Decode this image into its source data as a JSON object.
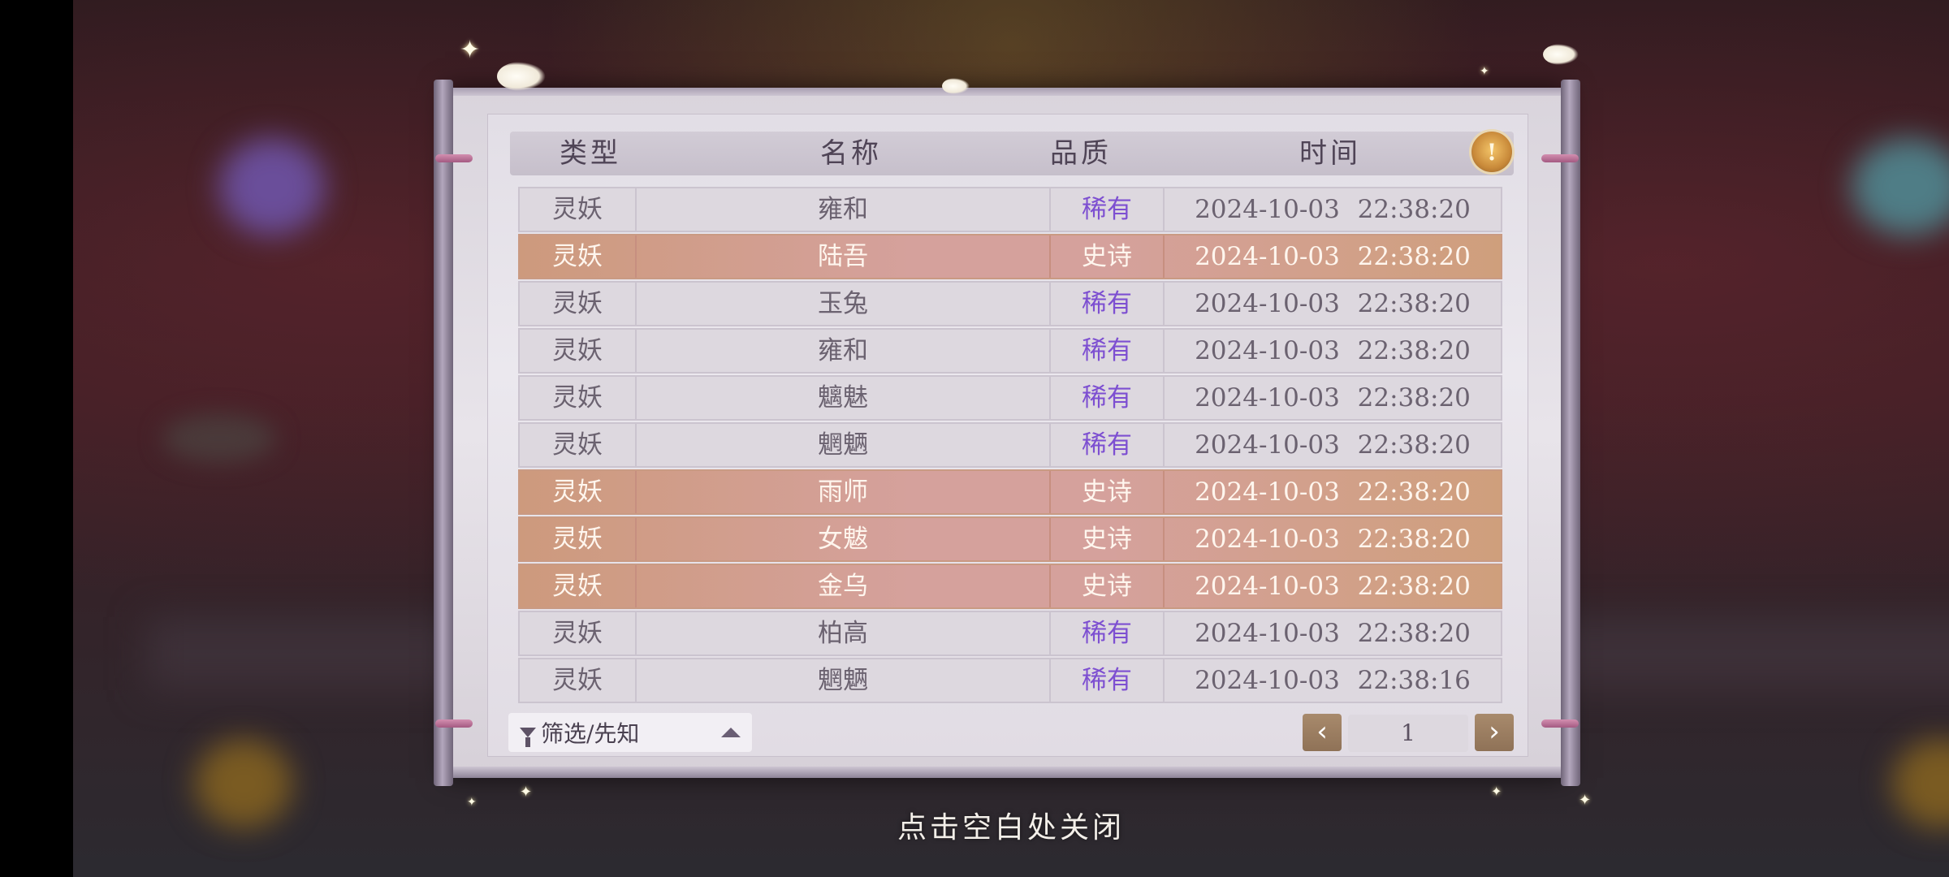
{
  "table": {
    "headers": {
      "type": "类型",
      "name": "名称",
      "quality": "品质",
      "time": "时间"
    },
    "rows": [
      {
        "type": "灵妖",
        "name": "雍和",
        "quality": "稀有",
        "time": "2024-10-03  22:38:20",
        "tier": "rare"
      },
      {
        "type": "灵妖",
        "name": "陆吾",
        "quality": "史诗",
        "time": "2024-10-03  22:38:20",
        "tier": "epic"
      },
      {
        "type": "灵妖",
        "name": "玉兔",
        "quality": "稀有",
        "time": "2024-10-03  22:38:20",
        "tier": "rare"
      },
      {
        "type": "灵妖",
        "name": "雍和",
        "quality": "稀有",
        "time": "2024-10-03  22:38:20",
        "tier": "rare"
      },
      {
        "type": "灵妖",
        "name": "魑魅",
        "quality": "稀有",
        "time": "2024-10-03  22:38:20",
        "tier": "rare"
      },
      {
        "type": "灵妖",
        "name": "魍魉",
        "quality": "稀有",
        "time": "2024-10-03  22:38:20",
        "tier": "rare"
      },
      {
        "type": "灵妖",
        "name": "雨师",
        "quality": "史诗",
        "time": "2024-10-03  22:38:20",
        "tier": "epic"
      },
      {
        "type": "灵妖",
        "name": "女魃",
        "quality": "史诗",
        "time": "2024-10-03  22:38:20",
        "tier": "epic"
      },
      {
        "type": "灵妖",
        "name": "金乌",
        "quality": "史诗",
        "time": "2024-10-03  22:38:20",
        "tier": "epic"
      },
      {
        "type": "灵妖",
        "name": "柏高",
        "quality": "稀有",
        "time": "2024-10-03  22:38:20",
        "tier": "rare"
      },
      {
        "type": "灵妖",
        "name": "魍魉",
        "quality": "稀有",
        "time": "2024-10-03  22:38:16",
        "tier": "rare"
      }
    ]
  },
  "filter": {
    "label": "筛选/先知"
  },
  "pagination": {
    "prev_icon": "chevron-left-icon",
    "next_icon": "chevron-right-icon",
    "prev_glyph": "‹",
    "next_glyph": "›",
    "current_page": "1"
  },
  "close_hint": "点击空白处关闭",
  "colors": {
    "rare": "#7d4fd1",
    "epic_row": "#d5a19c",
    "lamp": "#e0a54a"
  }
}
